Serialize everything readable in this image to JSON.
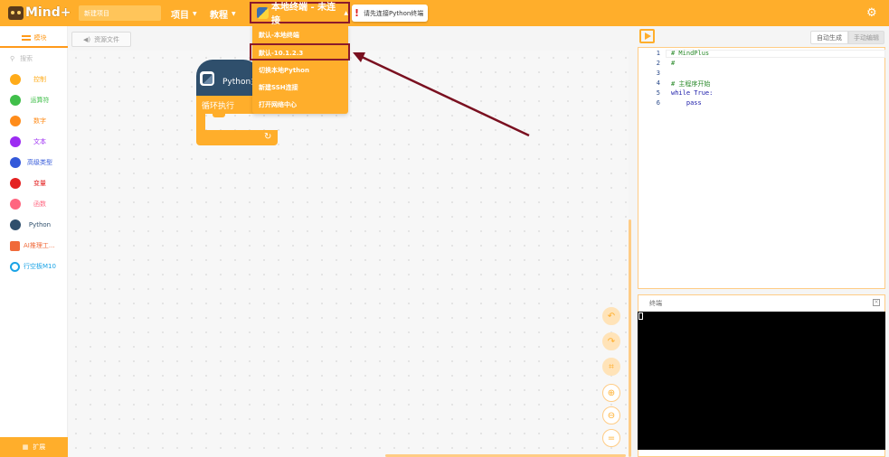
{
  "app": {
    "brand": "Mind+"
  },
  "header": {
    "project_name": "新建项目",
    "menu_project": "项目",
    "menu_tutorial": "教程",
    "terminal_selector": "本地终端 - 未连接",
    "tip_warn": "!",
    "tip_text": "请先连接Python终端"
  },
  "terminal_menu": {
    "items": [
      "默认-本地终端",
      "默认-10.1.2.3",
      "切换本地Python",
      "新建SSH连接",
      "打开网络中心"
    ],
    "highlighted_index": 1
  },
  "left_tabs": {
    "blocks": "模块",
    "assets": "资源文件"
  },
  "search": {
    "placeholder": "搜索"
  },
  "categories": [
    {
      "label": "控制",
      "color": "#ffab19"
    },
    {
      "label": "运算符",
      "color": "#40bf4a"
    },
    {
      "label": "数字",
      "color": "#ff8c1a"
    },
    {
      "label": "文本",
      "color": "#9c2cf2"
    },
    {
      "label": "高级类型",
      "color": "#3358d9"
    },
    {
      "label": "变量",
      "color": "#e42121"
    },
    {
      "label": "函数",
      "color": "#ff6680"
    },
    {
      "label": "Python",
      "color": "#2f4f6c"
    },
    {
      "label": "AI推理工...",
      "color": "#f06a3a"
    },
    {
      "label": "行空板M10",
      "color": "#1aa3e6"
    }
  ],
  "extension_button": "扩展",
  "blocks": {
    "hat_label": "Python主",
    "loop_label": "循环执行",
    "loop_arrow": "↻"
  },
  "code_toolbar": {
    "auto": "自动生成",
    "manual": "手动编辑"
  },
  "code": [
    {
      "n": "1",
      "text": "# MindPlus"
    },
    {
      "n": "2",
      "text": "#"
    },
    {
      "n": "3",
      "text": ""
    },
    {
      "n": "4",
      "text": "# 主程序开始"
    },
    {
      "n": "5",
      "text": "while True:"
    },
    {
      "n": "6",
      "text": "    pass"
    }
  ],
  "terminal": {
    "title": "终端",
    "close": "×"
  },
  "zoom_controls": [
    "undo-icon",
    "redo-icon",
    "crop-icon",
    "zoom-in-icon",
    "zoom-out-icon",
    "reset-zoom-icon"
  ],
  "colors": {
    "accent": "#ffae2b",
    "highlight_border": "#8b1a2b",
    "arrow": "#7a1020"
  }
}
